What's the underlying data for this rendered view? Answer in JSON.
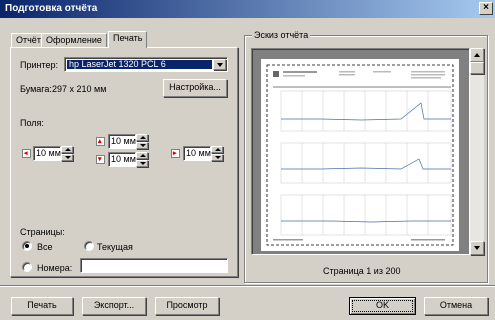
{
  "window": {
    "title": "Подготовка отчёта",
    "close_glyph": "×"
  },
  "tabs": [
    {
      "label": "Отчёт"
    },
    {
      "label": "Оформление"
    },
    {
      "label": "Печать",
      "active": true
    }
  ],
  "print": {
    "printer_label": "Принтер:",
    "printer_value": "hp LaserJet 1320 PCL 6",
    "paper_label": "Бумага:",
    "paper_value": "297 x 210 мм",
    "settings_button": "Настройка...",
    "margins_label": "Поля:",
    "margin_left": "10 мм",
    "margin_top": "10 мм",
    "margin_bottom": "10 мм",
    "margin_right": "10 мм",
    "pages_label": "Страницы:",
    "all_label": "Все",
    "current_label": "Текущая",
    "numbers_label": "Номера:",
    "numbers_value": "",
    "selected_range": "all"
  },
  "preview": {
    "legend": "Эскиз отчёта",
    "page_status": "Страница 1 из 200"
  },
  "buttons": {
    "print": "Печать",
    "export": "Экспорт...",
    "view": "Просмотр",
    "ok": "OK",
    "cancel": "Отмена"
  }
}
